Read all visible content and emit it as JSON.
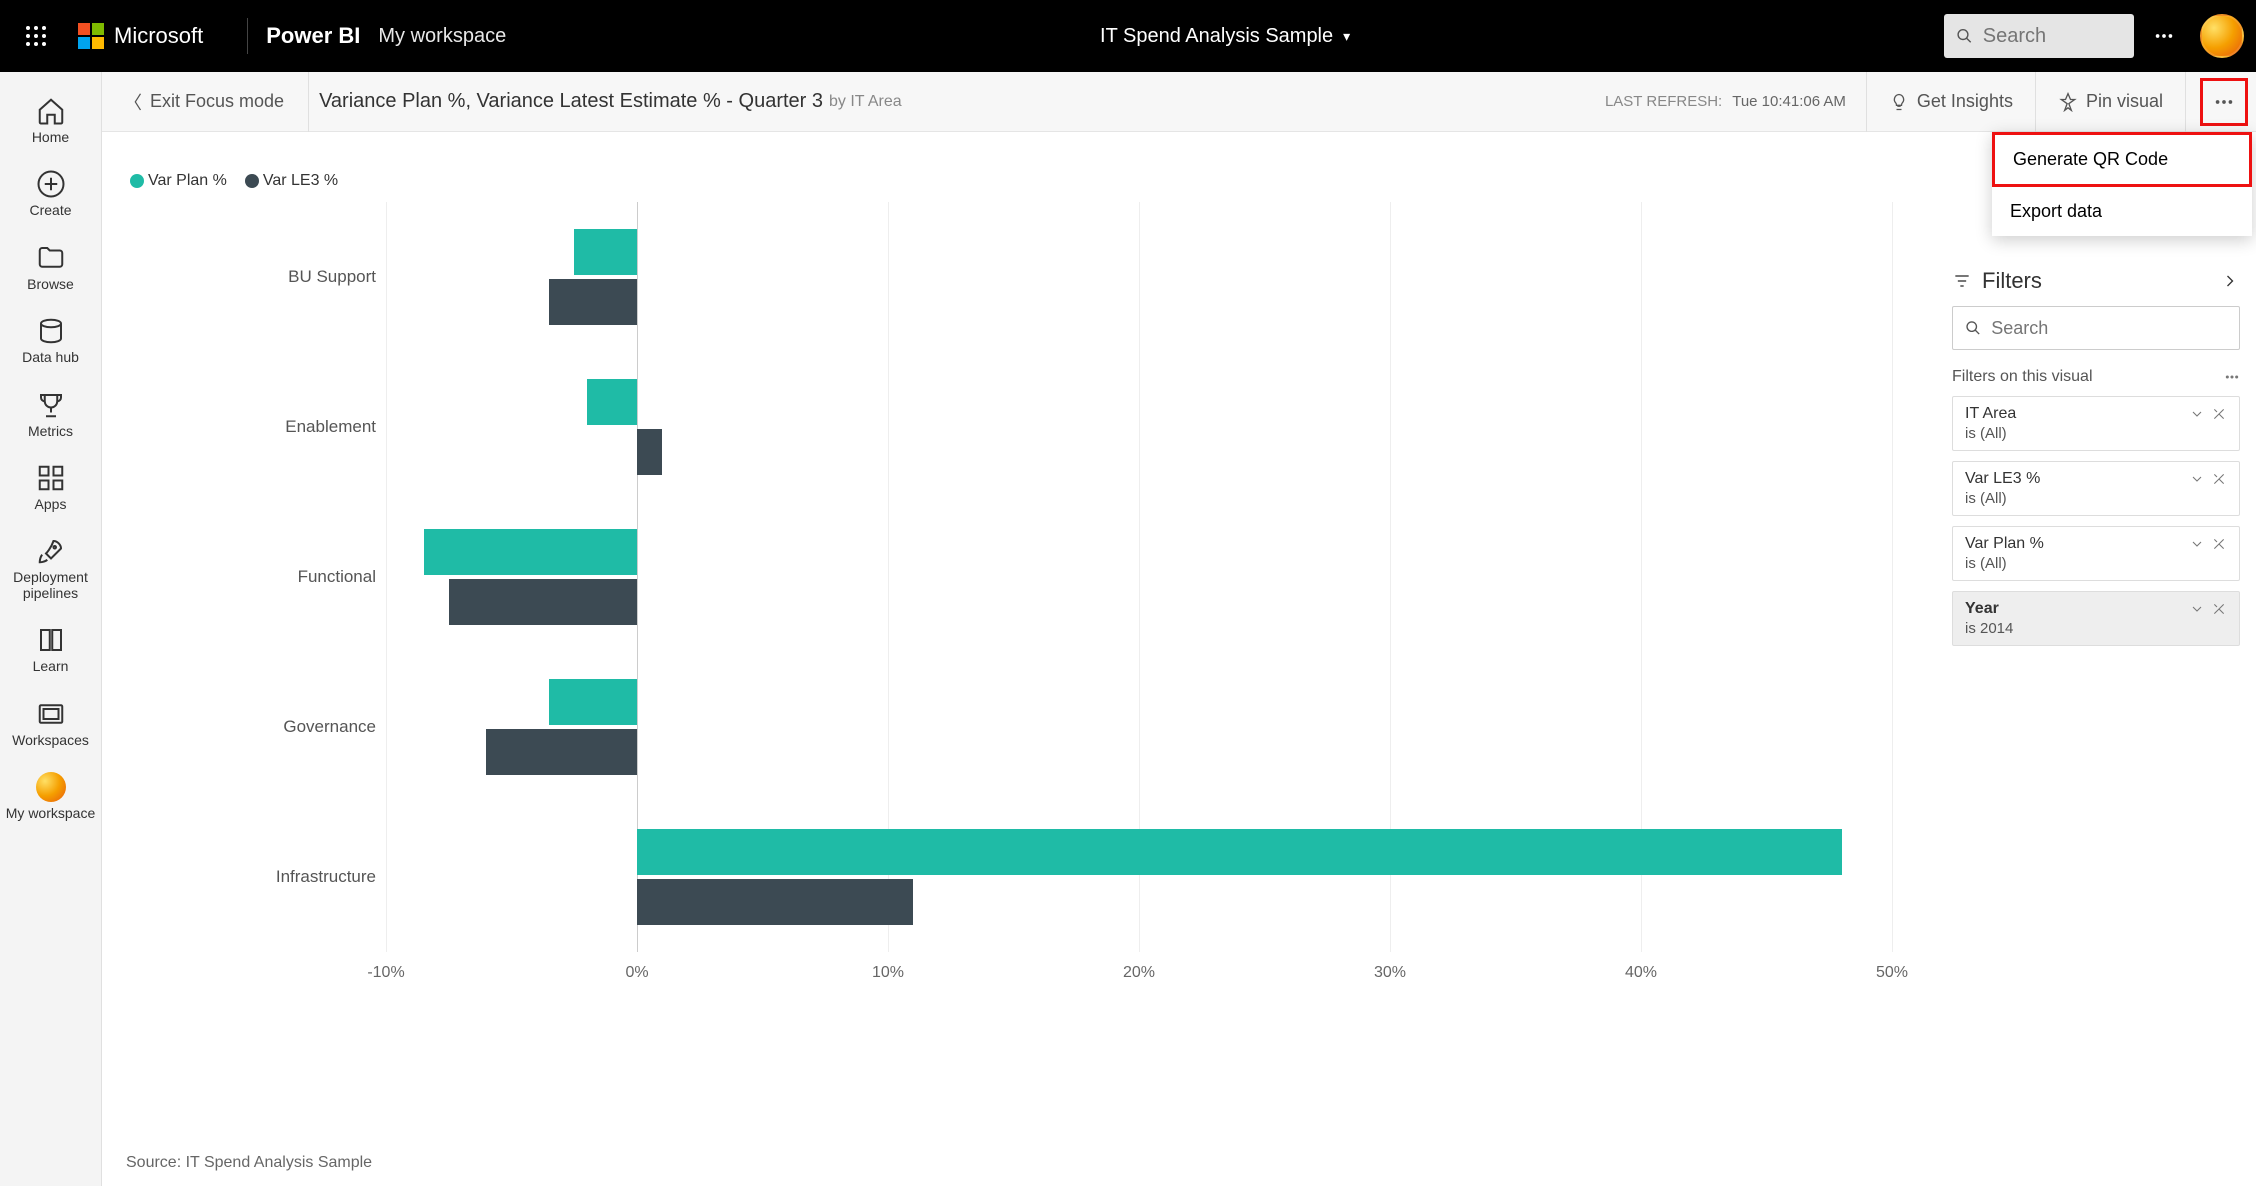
{
  "topbar": {
    "brand": "Microsoft",
    "product": "Power BI",
    "workspace": "My workspace",
    "report_title": "IT Spend Analysis Sample",
    "search_placeholder": "Search"
  },
  "leftnav": {
    "items": [
      {
        "label": "Home",
        "icon": "home-icon"
      },
      {
        "label": "Create",
        "icon": "plus-circle-icon"
      },
      {
        "label": "Browse",
        "icon": "folder-icon"
      },
      {
        "label": "Data hub",
        "icon": "data-hub-icon"
      },
      {
        "label": "Metrics",
        "icon": "trophy-icon"
      },
      {
        "label": "Apps",
        "icon": "apps-icon"
      },
      {
        "label": "Deployment pipelines",
        "icon": "rocket-icon"
      },
      {
        "label": "Learn",
        "icon": "book-icon"
      },
      {
        "label": "Workspaces",
        "icon": "workspaces-icon"
      },
      {
        "label": "My workspace",
        "icon": "avatar-icon"
      }
    ]
  },
  "subheader": {
    "exit_focus": "Exit Focus mode",
    "title": "Variance Plan %, Variance Latest Estimate % - Quarter 3",
    "subtitle": "by IT Area",
    "last_refresh_label": "LAST REFRESH:",
    "last_refresh_value": "Tue 10:41:06 AM",
    "get_insights": "Get Insights",
    "pin_visual": "Pin visual"
  },
  "dropdown": {
    "generate_qr": "Generate QR Code",
    "export_data": "Export data"
  },
  "filters_pane": {
    "title": "Filters",
    "search_placeholder": "Search",
    "section_title": "Filters on this visual",
    "cards": [
      {
        "name": "IT Area",
        "value": "is (All)",
        "active": false
      },
      {
        "name": "Var LE3 %",
        "value": "is (All)",
        "active": false
      },
      {
        "name": "Var Plan %",
        "value": "is (All)",
        "active": false
      },
      {
        "name": "Year",
        "value": "is 2014",
        "active": true
      }
    ]
  },
  "source_note": "Source: IT Spend Analysis Sample",
  "colors": {
    "series1": "#1fbba6",
    "series2": "#3c4a53"
  },
  "chart_data": {
    "type": "bar",
    "orientation": "horizontal",
    "title": "Variance Plan %, Variance Latest Estimate % - Quarter 3 by IT Area",
    "xlabel": "",
    "ylabel": "IT Area",
    "xlim": [
      -10,
      50
    ],
    "x_ticks": [
      "-10%",
      "0%",
      "10%",
      "20%",
      "30%",
      "40%",
      "50%"
    ],
    "categories": [
      "BU Support",
      "Enablement",
      "Functional",
      "Governance",
      "Infrastructure"
    ],
    "series": [
      {
        "name": "Var Plan %",
        "color": "#1fbba6",
        "values": [
          -2.5,
          -2,
          -8.5,
          -3.5,
          48
        ]
      },
      {
        "name": "Var LE3 %",
        "color": "#3c4a53",
        "values": [
          -3.5,
          1,
          -7.5,
          -6,
          11
        ]
      }
    ],
    "legend_position": "top-left",
    "grid": true
  }
}
